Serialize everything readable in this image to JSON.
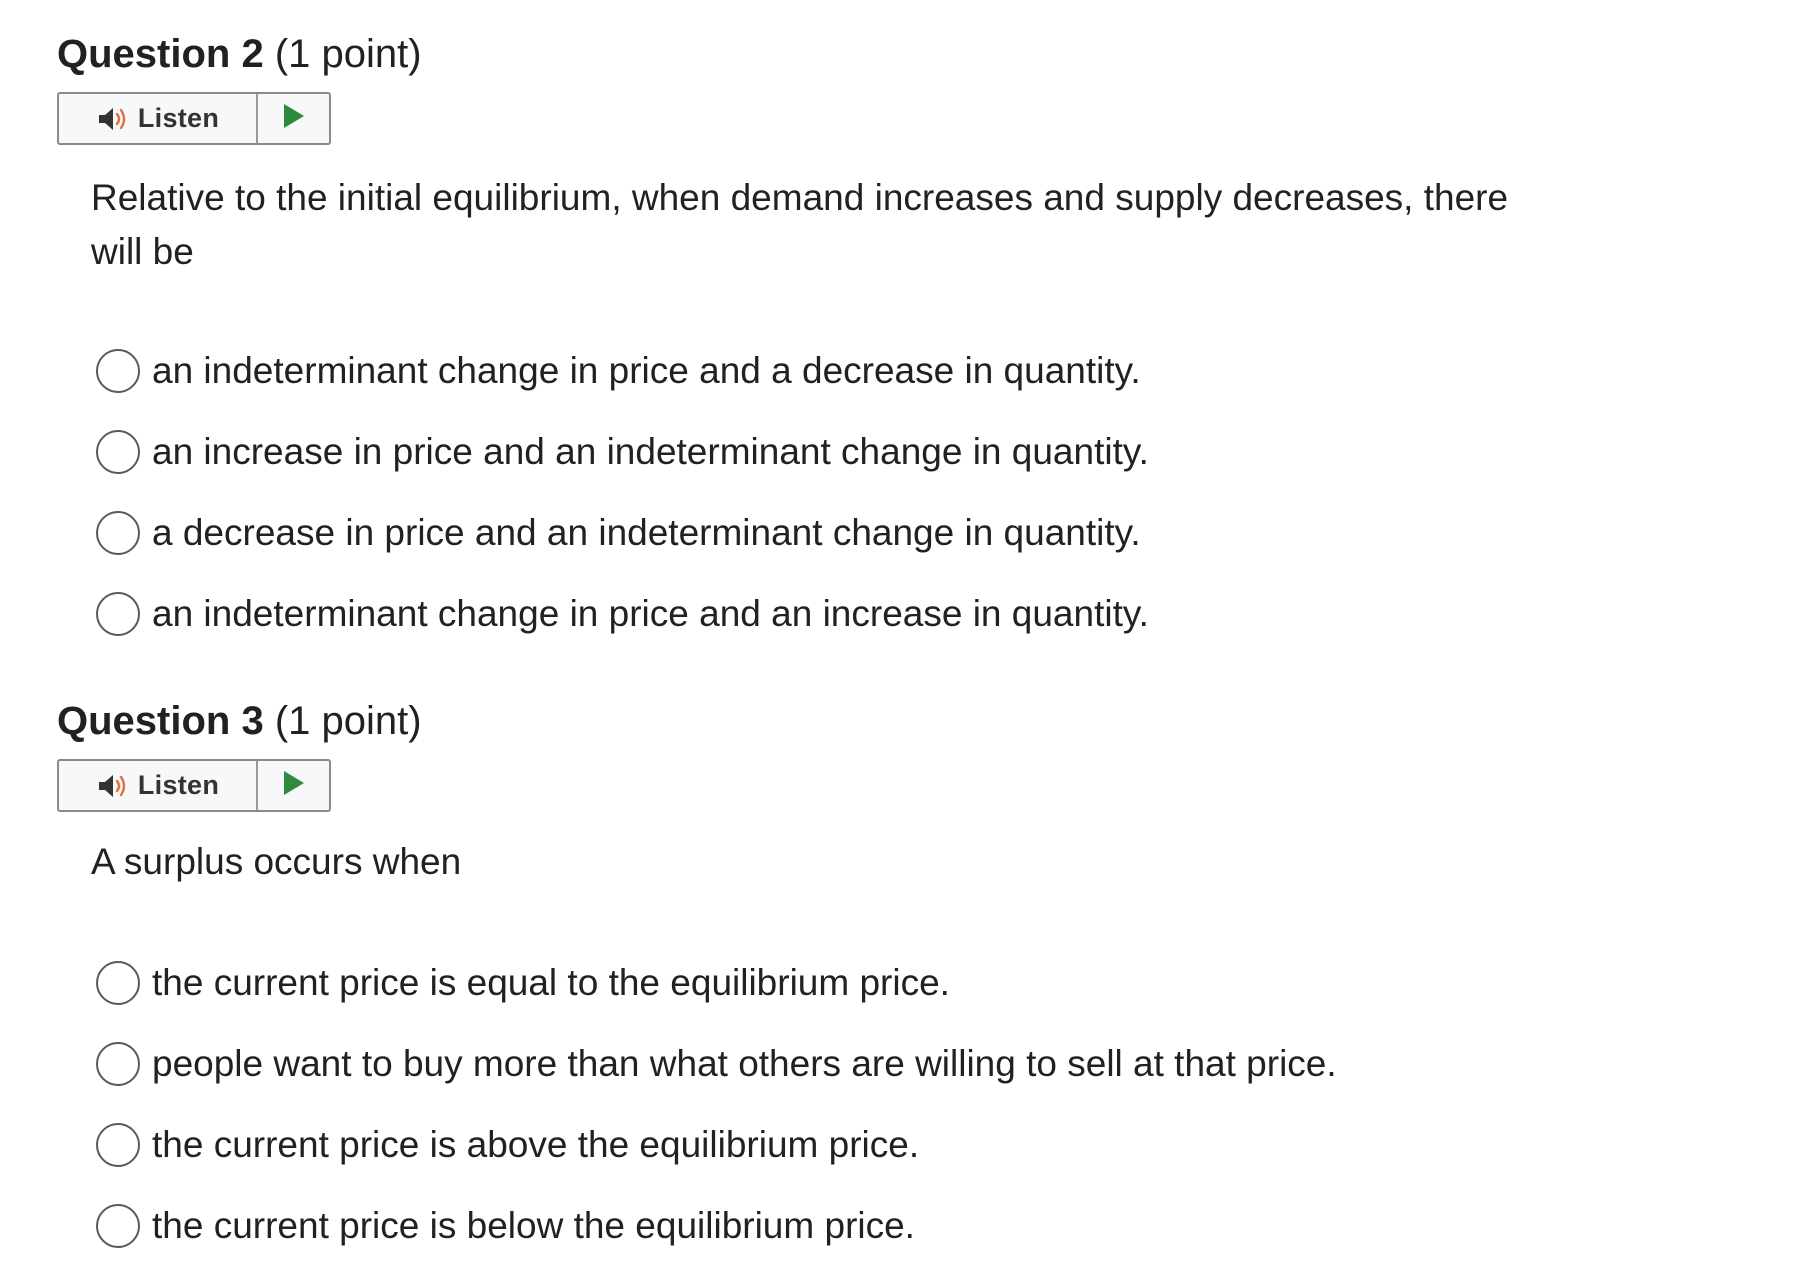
{
  "questions": [
    {
      "number_label": "Question 2",
      "points_label": "(1 point)",
      "listen_label": "Listen",
      "prompt": "Relative to the initial equilibrium, when demand increases and supply decreases, there will be",
      "options": [
        "an indeterminant change in price and a decrease in quantity.",
        "an increase in price and an indeterminant change in quantity.",
        "a decrease in price and an indeterminant change in quantity.",
        "an indeterminant change in price and an increase in quantity."
      ]
    },
    {
      "number_label": "Question 3",
      "points_label": "(1 point)",
      "listen_label": "Listen",
      "prompt": "A surplus occurs when",
      "options": [
        "the current price is equal to the equilibrium price.",
        "people want to buy more than what others are willing to sell at that price.",
        "the current price is above the equilibrium price.",
        "the current price is below the equilibrium price."
      ]
    }
  ],
  "icons": {
    "speaker": "speaker-icon",
    "play": "play-icon",
    "radio": "radio-unselected"
  },
  "colors": {
    "text": "#202122",
    "speaker_body": "#333333",
    "speaker_waves": "#e0703a",
    "play_triangle": "#2e8b3e",
    "radio_border": "#565a5c",
    "widget_border": "#8a8a8a"
  }
}
